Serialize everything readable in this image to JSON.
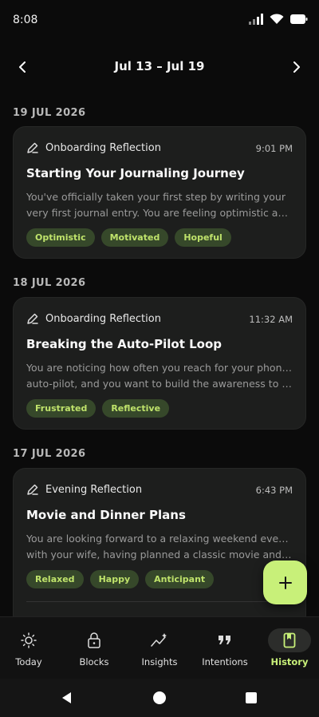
{
  "status_bar": {
    "time": "8:08"
  },
  "header": {
    "week_label": "Jul 13 – Jul 19"
  },
  "days": [
    {
      "date": "19 JUL 2026",
      "entry": {
        "type": "Onboarding Reflection",
        "time": "9:01 PM",
        "title": "Starting Your Journaling Journey",
        "body_line1": "You've officially taken your first step by writing your",
        "body_line2": "very first journal entry. You are feeling optimistic and ...",
        "tags": [
          "Optimistic",
          "Motivated",
          "Hopeful"
        ]
      }
    },
    {
      "date": "18 JUL 2026",
      "entry": {
        "type": "Onboarding Reflection",
        "time": "11:32 AM",
        "title": "Breaking the Auto-Pilot Loop",
        "body_line1": "You are noticing how often you reach for your phone on",
        "body_line2": "auto-pilot, and you want to build the awareness to sta...",
        "tags": [
          "Frustrated",
          "Reflective"
        ]
      }
    },
    {
      "date": "17 JUL 2026",
      "entry": {
        "type": "Evening Reflection",
        "time": "6:43 PM",
        "title": "Movie and Dinner Plans",
        "body_line1": "You are looking forward to a relaxing weekend evening",
        "body_line2": "with your wife, having planned a classic movie and din...",
        "tags": [
          "Relaxed",
          "Happy",
          "Anticipant"
        ]
      }
    }
  ],
  "bottom_nav": {
    "items": [
      {
        "label": "Today",
        "icon": "sun-icon"
      },
      {
        "label": "Blocks",
        "icon": "lock-icon"
      },
      {
        "label": "Insights",
        "icon": "trend-sparkle-icon"
      },
      {
        "label": "Intentions",
        "icon": "quote-icon"
      },
      {
        "label": "History",
        "icon": "book-icon",
        "active": true
      }
    ]
  },
  "colors": {
    "background": "#0b0b0b",
    "card": "#1d1e1d",
    "accent": "#c8f079",
    "tag_bg": "#36482a",
    "tag_text": "#bfe36b"
  }
}
